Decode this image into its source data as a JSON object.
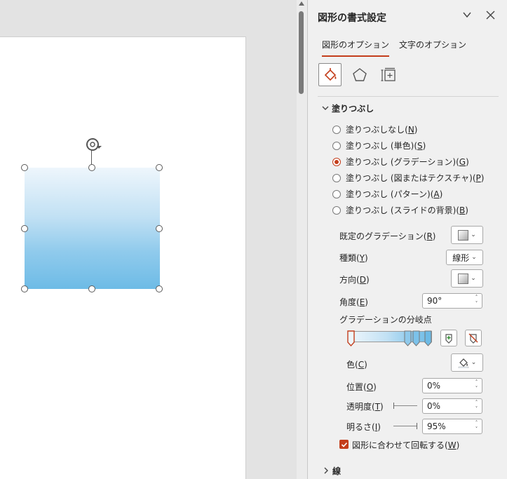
{
  "pane": {
    "title": "図形の書式設定",
    "tabs": {
      "shape": "図形のオプション",
      "text": "文字のオプション"
    },
    "fill_section": "塗りつぶし",
    "line_section": "線"
  },
  "fill": {
    "options": [
      {
        "label": "塗りつぶしなし",
        "key": "N",
        "checked": false
      },
      {
        "label": "塗りつぶし (単色)",
        "key": "S",
        "checked": false
      },
      {
        "label": "塗りつぶし (グラデーション)",
        "key": "G",
        "checked": true
      },
      {
        "label": "塗りつぶし (図またはテクスチャ)",
        "key": "P",
        "checked": false
      },
      {
        "label": "塗りつぶし (パターン)",
        "key": "A",
        "checked": false
      },
      {
        "label": "塗りつぶし (スライドの背景)",
        "key": "B",
        "checked": false
      }
    ],
    "preset_label": "既定のグラデーション",
    "preset_key": "R",
    "type_label": "種類",
    "type_key": "Y",
    "type_value": "線形",
    "direction_label": "方向",
    "direction_key": "D",
    "angle_label": "角度",
    "angle_key": "E",
    "angle_value": "90°",
    "stops_label": "グラデーションの分岐点",
    "color_label": "色",
    "color_key": "C",
    "position_label": "位置",
    "position_key": "O",
    "position_value": "0%",
    "transparency_label": "透明度",
    "transparency_key": "T",
    "transparency_value": "0%",
    "brightness_label": "明るさ",
    "brightness_key": "I",
    "brightness_value": "95%",
    "rotate_label": "図形に合わせて回転する",
    "rotate_key": "W",
    "rotate_checked": true
  },
  "colors": {
    "accent": "#c43e1c",
    "gradient_light": "#eef6fc",
    "gradient_dark": "#6dbbe6"
  }
}
